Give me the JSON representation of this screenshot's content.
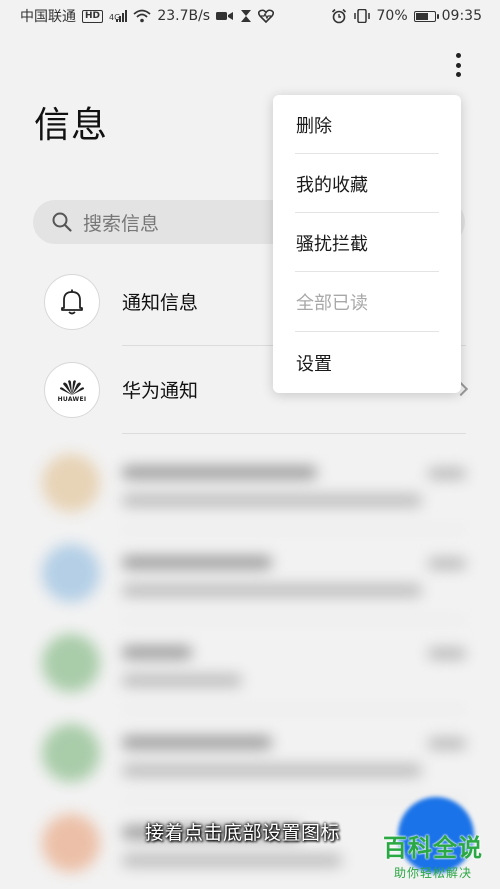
{
  "status_bar": {
    "carrier": "中国联通",
    "hd_badge": "HD",
    "network_type": "4G",
    "speed": "23.7B/s",
    "battery_percent": "70%",
    "battery_level": 0.7,
    "time": "09:35",
    "icons": [
      "hd-icon",
      "signal-icon",
      "wifi-icon",
      "video-icon",
      "hourglass-icon",
      "heart-icon",
      "alarm-icon",
      "vibrate-icon",
      "battery-icon"
    ]
  },
  "header": {
    "title": "信息",
    "more_icon": "more-vertical-icon"
  },
  "search": {
    "placeholder": "搜索信息",
    "icon": "search-icon"
  },
  "conversations": [
    {
      "name": "通知信息",
      "icon": "bell-icon"
    },
    {
      "name": "华为通知",
      "icon": "huawei-logo",
      "logo_text": "HUAWEI"
    }
  ],
  "menu": {
    "items": [
      {
        "label": "删除",
        "enabled": true
      },
      {
        "label": "我的收藏",
        "enabled": true
      },
      {
        "label": "骚扰拦截",
        "enabled": true
      },
      {
        "label": "全部已读",
        "enabled": false
      },
      {
        "label": "设置",
        "enabled": true
      }
    ]
  },
  "caption": "接着点击底部设置图标",
  "watermark": {
    "title": "百科全说",
    "subtitle": "助你轻松解决"
  },
  "colors": {
    "accent": "#1a73e8",
    "watermark_green": "#2aa843",
    "background": "#f2f2f2"
  }
}
